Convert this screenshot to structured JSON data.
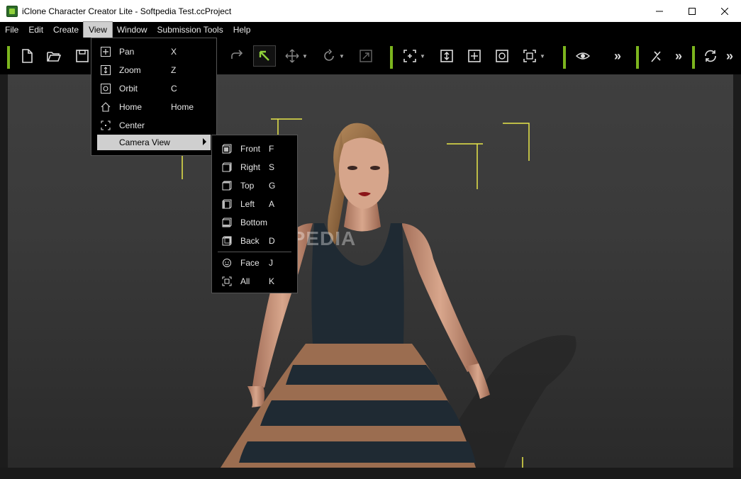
{
  "window": {
    "title": "iClone Character Creator Lite - Softpedia Test.ccProject",
    "icons": {
      "app": "iclone-app-icon",
      "minimize": "minimize-icon",
      "maximize": "maximize-icon",
      "close": "close-icon"
    }
  },
  "menubar": {
    "items": [
      {
        "label": "File"
      },
      {
        "label": "Edit"
      },
      {
        "label": "Create"
      },
      {
        "label": "View",
        "active": true
      },
      {
        "label": "Window"
      },
      {
        "label": "Submission Tools"
      },
      {
        "label": "Help"
      }
    ]
  },
  "toolbar": {
    "accent_color": "#7cb51e",
    "icons": [
      "new-file-icon",
      "open-folder-icon",
      "save-icon",
      "redo-icon",
      "select-arrow-icon",
      "move-icon",
      "rotate-icon",
      "scale-icon",
      "zoom-region-icon",
      "zoom-icon",
      "pan-icon",
      "orbit-icon",
      "fit-view-icon",
      "eye-icon",
      "more-icon",
      "pose-icon",
      "more-icon",
      "refresh-icon",
      "more-icon"
    ]
  },
  "view_menu": {
    "items": [
      {
        "label": "Pan",
        "shortcut": "X",
        "icon": "pan-icon"
      },
      {
        "label": "Zoom",
        "shortcut": "Z",
        "icon": "zoom-icon"
      },
      {
        "label": "Orbit",
        "shortcut": "C",
        "icon": "orbit-icon"
      },
      {
        "label": "Home",
        "shortcut": "Home",
        "icon": "home-icon"
      },
      {
        "label": "Center",
        "shortcut": "",
        "icon": "center-icon"
      },
      {
        "label": "Camera View",
        "shortcut": "",
        "icon": "",
        "highlighted": true,
        "submenu": true
      }
    ]
  },
  "camera_view_menu": {
    "items": [
      {
        "label": "Front",
        "shortcut": "F",
        "icon": "cube-front-icon"
      },
      {
        "label": "Right",
        "shortcut": "S",
        "icon": "cube-right-icon"
      },
      {
        "label": "Top",
        "shortcut": "G",
        "icon": "cube-top-icon"
      },
      {
        "label": "Left",
        "shortcut": "A",
        "icon": "cube-left-icon"
      },
      {
        "label": "Bottom",
        "shortcut": "",
        "icon": "cube-bottom-icon"
      },
      {
        "label": "Back",
        "shortcut": "D",
        "icon": "cube-back-icon"
      },
      {
        "label": "Face",
        "shortcut": "J",
        "icon": "face-icon"
      },
      {
        "label": "All",
        "shortcut": "K",
        "icon": "fit-all-icon"
      }
    ]
  },
  "viewport": {
    "watermark": "SOFTPEDIA",
    "guide_color": "#e8e64a"
  }
}
